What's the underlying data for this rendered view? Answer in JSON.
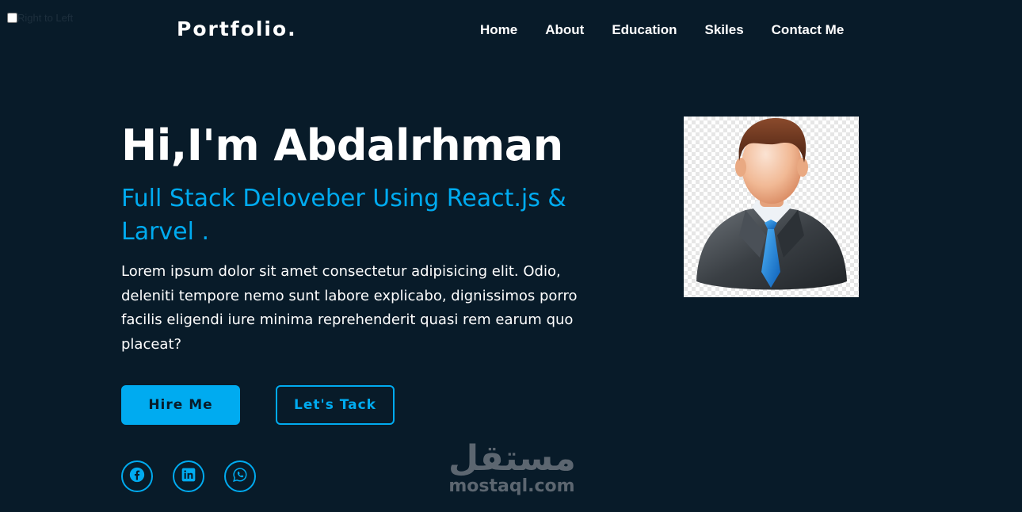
{
  "rtl_toggle": {
    "label": "Right to Left",
    "checked": false
  },
  "header": {
    "logo": "Portfolio.",
    "nav": [
      {
        "label": "Home"
      },
      {
        "label": "About"
      },
      {
        "label": "Education"
      },
      {
        "label": "Skiles"
      },
      {
        "label": "Contact Me"
      }
    ]
  },
  "hero": {
    "title": "Hi,I'm Abdalrhman",
    "subtitle": "Full Stack Deloveber Using React.js & Larvel .",
    "description": "Lorem ipsum dolor sit amet consectetur adipisicing elit. Odio, deleniti tempore nemo sunt labore explicabo, dignissimos porro facilis eligendi iure minima reprehenderit quasi rem earum quo placeat?",
    "buttons": {
      "hire": "Hire Me",
      "talk": "Let's Tack"
    },
    "socials": [
      {
        "icon": "facebook-icon"
      },
      {
        "icon": "linkedin-icon"
      },
      {
        "icon": "whatsapp-icon"
      }
    ]
  },
  "avatar": {
    "icon": "businessman-avatar-icon"
  },
  "watermark": {
    "logo": "مستقل",
    "url": "mostaql.com"
  },
  "colors": {
    "background": "#081b29",
    "accent": "#00abf0",
    "text": "#ffffff"
  }
}
